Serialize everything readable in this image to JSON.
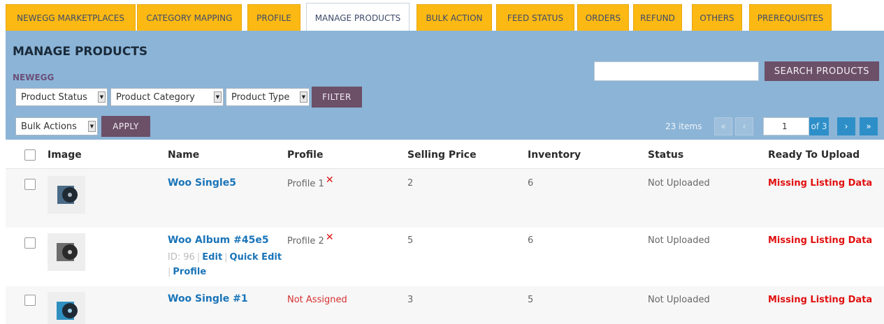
{
  "tabs": [
    {
      "label": "NEWEGG MARKETPLACES",
      "active": false
    },
    {
      "label": "CATEGORY MAPPING",
      "active": false
    },
    {
      "label": "PROFILE",
      "active": false
    },
    {
      "label": "MANAGE PRODUCTS",
      "active": true
    },
    {
      "label": "BULK ACTION",
      "active": false
    },
    {
      "label": "FEED STATUS",
      "active": false
    },
    {
      "label": "ORDERS",
      "active": false
    },
    {
      "label": "REFUND",
      "active": false
    },
    {
      "label": "OTHERS",
      "active": false
    },
    {
      "label": "PREREQUISITES",
      "active": false
    }
  ],
  "page": {
    "title": "MANAGE PRODUCTS",
    "subtitle": "NEWEGG"
  },
  "search": {
    "value": "",
    "button_label": "SEARCH PRODUCTS"
  },
  "filters": {
    "product_status": "Product Status",
    "product_category": "Product Category",
    "product_type": "Product Type",
    "filter_label": "FILTER"
  },
  "bulk": {
    "selected": "Bulk Actions",
    "apply_label": "APPLY"
  },
  "pagination": {
    "items": "23 items",
    "first": "«",
    "prev": "‹",
    "current": "1",
    "of": "of 3",
    "next": "›",
    "last": "»"
  },
  "table": {
    "headers": {
      "image": "Image",
      "name": "Name",
      "profile": "Profile",
      "price": "Selling Price",
      "inventory": "Inventory",
      "status": "Status",
      "ready": "Ready To Upload"
    },
    "rows": [
      {
        "name": "Woo Single5",
        "profile": "Profile 1",
        "profile_remove": "✕",
        "price": "2",
        "inventory": "6",
        "status": "Not Uploaded",
        "ready": "Missing Listing Data",
        "thumb_color": "#4a6a86"
      },
      {
        "name": "Woo Album #45e5",
        "profile": "Profile 2",
        "profile_remove": "✕",
        "price": "5",
        "inventory": "6",
        "status": "Not Uploaded",
        "ready": "Missing Listing Data",
        "thumb_color": "#6d6d6d",
        "id_label": "ID: 96",
        "edit": "Edit",
        "quick_edit": "Quick Edit",
        "profile_action": "Profile"
      },
      {
        "name": "Woo Single #1",
        "profile": "Not Assigned",
        "price": "3",
        "inventory": "5",
        "status": "Not Uploaded",
        "ready": "Missing Listing Data",
        "thumb_color": "#2f8fc0"
      }
    ]
  },
  "colors": {
    "tab": "#fdb913",
    "panel": "#8cb4d6",
    "button": "#6b5068",
    "link": "#1a74b8",
    "missing": "#e10f0f"
  }
}
